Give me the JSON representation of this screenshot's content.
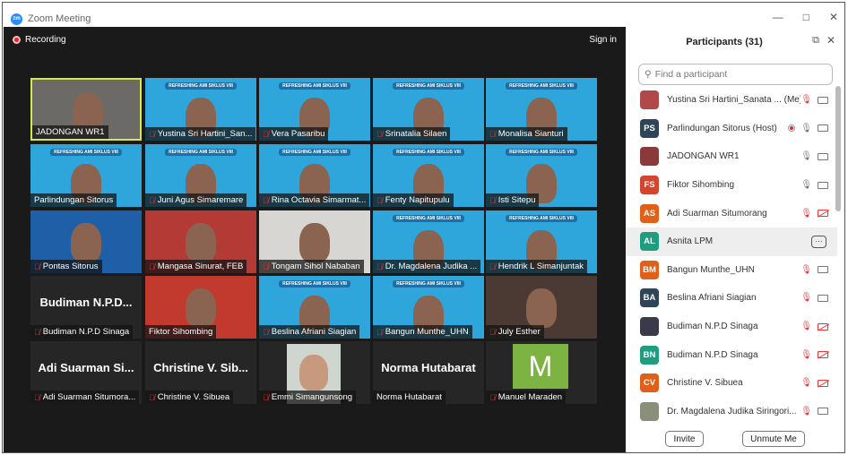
{
  "window": {
    "title": "Zoom Meeting",
    "logo": "zm"
  },
  "meeting": {
    "recording_label": "Recording",
    "sign_in": "Sign in",
    "slide_text": "REFRESHING AMI SIKLUS VIII",
    "tiles": [
      {
        "name": "JADONGAN WR1",
        "muted": false,
        "active": true,
        "bg": "#6b6a66"
      },
      {
        "name": "Yustina Sri Hartini_San...",
        "muted": true,
        "bg": "#2ea6db",
        "slide": true
      },
      {
        "name": "Vera Pasaribu",
        "muted": true,
        "bg": "#2ea6db",
        "slide": true
      },
      {
        "name": "Srinatalia Silaen",
        "muted": true,
        "bg": "#2ea6db",
        "slide": true
      },
      {
        "name": "Monalisa Sianturi",
        "muted": true,
        "bg": "#2ea6db",
        "slide": true
      },
      {
        "name": "Parlindungan Sitorus",
        "muted": false,
        "bg": "#2ea6db",
        "slide": true
      },
      {
        "name": "Juni Agus Simaremare",
        "muted": true,
        "bg": "#2ea6db",
        "slide": true
      },
      {
        "name": "Rina Octavia Simarmat...",
        "muted": true,
        "bg": "#2ea6db",
        "slide": true
      },
      {
        "name": "Fenty Napitupulu",
        "muted": true,
        "bg": "#2ea6db",
        "slide": true
      },
      {
        "name": "Isti Sitepu",
        "muted": true,
        "bg": "#2ea6db",
        "slide": true
      },
      {
        "name": "Pontas Sitorus",
        "muted": true,
        "bg": "#1f5fa8"
      },
      {
        "name": "Mangasa Sinurat, FEB",
        "muted": true,
        "bg": "#b33a35"
      },
      {
        "name": "Tongam Sihol Nababan",
        "muted": true,
        "bg": "#d8d6d2"
      },
      {
        "name": "Dr. Magdalena Judika ...",
        "muted": true,
        "bg": "#2ea6db",
        "slide": true
      },
      {
        "name": "Hendrik L Simanjuntak",
        "muted": true,
        "bg": "#2ea6db",
        "slide": true
      },
      {
        "name": "Budiman N.P.D Sinaga",
        "muted": true,
        "big": "Budiman  N.P.D..."
      },
      {
        "name": "Fiktor Sihombing",
        "muted": false,
        "bg": "#c23a2e"
      },
      {
        "name": "Beslina Afriani Siagian",
        "muted": true,
        "bg": "#2ea6db",
        "slide": true
      },
      {
        "name": "Bangun Munthe_UHN",
        "muted": true,
        "bg": "#2ea6db",
        "slide": true
      },
      {
        "name": "July Esther",
        "muted": true,
        "bg": "#4a3a33"
      },
      {
        "name": "Adi Suarman Situmora...",
        "muted": true,
        "big": "Adi  Suarman  Si..."
      },
      {
        "name": "Christine V. Sibuea",
        "muted": true,
        "big": "Christine  V.  Sib..."
      },
      {
        "name": "Emmi Simangunsong",
        "muted": true,
        "photo": true
      },
      {
        "name": "Norma Hutabarat",
        "muted": false,
        "big": "Norma Hutabarat"
      },
      {
        "name": "Manuel Maraden",
        "muted": true,
        "letter": "M"
      }
    ]
  },
  "participants": {
    "title": "Participants (31)",
    "search_placeholder": "Find a participant",
    "items": [
      {
        "name": "Yustina Sri Hartini_Sanata ... (Me)",
        "initials": "",
        "color": "#b04a4a",
        "mic": "off",
        "video": "on"
      },
      {
        "name": "Parlindungan Sitorus (Host)",
        "initials": "PS",
        "color": "#2f4458",
        "mic": "on",
        "video": "on",
        "recording": true
      },
      {
        "name": "JADONGAN WR1",
        "initials": "",
        "color": "#8a3a3a",
        "mic": "on",
        "video": "on"
      },
      {
        "name": "Fiktor Sihombing",
        "initials": "FS",
        "color": "#d2452f",
        "mic": "on",
        "video": "on"
      },
      {
        "name": "Adi Suarman Situmorang",
        "initials": "AS",
        "color": "#e0601a",
        "mic": "off",
        "video": "off"
      },
      {
        "name": "Asnita LPM",
        "initials": "AL",
        "color": "#1e9e7e",
        "more": true
      },
      {
        "name": "Bangun Munthe_UHN",
        "initials": "BM",
        "color": "#e0601a",
        "mic": "off",
        "video": "on"
      },
      {
        "name": "Beslina Afriani Siagian",
        "initials": "BA",
        "color": "#2f4458",
        "mic": "off",
        "video": "on"
      },
      {
        "name": "Budiman N.P.D Sinaga",
        "initials": "",
        "color": "#3a3a4a",
        "mic": "off",
        "video": "off"
      },
      {
        "name": "Budiman N.P.D Sinaga",
        "initials": "BN",
        "color": "#1e9e7e",
        "mic": "off",
        "video": "off"
      },
      {
        "name": "Christine V. Sibuea",
        "initials": "CV",
        "color": "#e0601a",
        "mic": "off",
        "video": "off"
      },
      {
        "name": "Dr. Magdalena Judika Siringori...",
        "initials": "",
        "color": "#8a8f7a",
        "mic": "off",
        "video": "on"
      }
    ],
    "invite_label": "Invite",
    "unmute_label": "Unmute Me"
  }
}
